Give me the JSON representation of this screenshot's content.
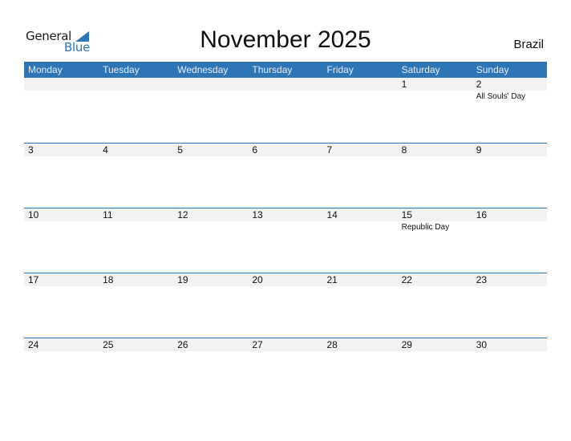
{
  "logo": {
    "word1": "General",
    "word2": "Blue"
  },
  "title": "November 2025",
  "country": "Brazil",
  "colors": {
    "accent": "#2e75b6",
    "strip": "#f2f2f2"
  },
  "weekdays": [
    "Monday",
    "Tuesday",
    "Wednesday",
    "Thursday",
    "Friday",
    "Saturday",
    "Sunday"
  ],
  "weeks": [
    [
      {
        "day": ""
      },
      {
        "day": ""
      },
      {
        "day": ""
      },
      {
        "day": ""
      },
      {
        "day": ""
      },
      {
        "day": "1"
      },
      {
        "day": "2",
        "holiday": "All Souls' Day"
      }
    ],
    [
      {
        "day": "3"
      },
      {
        "day": "4"
      },
      {
        "day": "5"
      },
      {
        "day": "6"
      },
      {
        "day": "7"
      },
      {
        "day": "8"
      },
      {
        "day": "9"
      }
    ],
    [
      {
        "day": "10"
      },
      {
        "day": "11"
      },
      {
        "day": "12"
      },
      {
        "day": "13"
      },
      {
        "day": "14"
      },
      {
        "day": "15",
        "holiday": "Republic Day"
      },
      {
        "day": "16"
      }
    ],
    [
      {
        "day": "17"
      },
      {
        "day": "18"
      },
      {
        "day": "19"
      },
      {
        "day": "20"
      },
      {
        "day": "21"
      },
      {
        "day": "22"
      },
      {
        "day": "23"
      }
    ],
    [
      {
        "day": "24"
      },
      {
        "day": "25"
      },
      {
        "day": "26"
      },
      {
        "day": "27"
      },
      {
        "day": "28"
      },
      {
        "day": "29"
      },
      {
        "day": "30"
      }
    ]
  ]
}
